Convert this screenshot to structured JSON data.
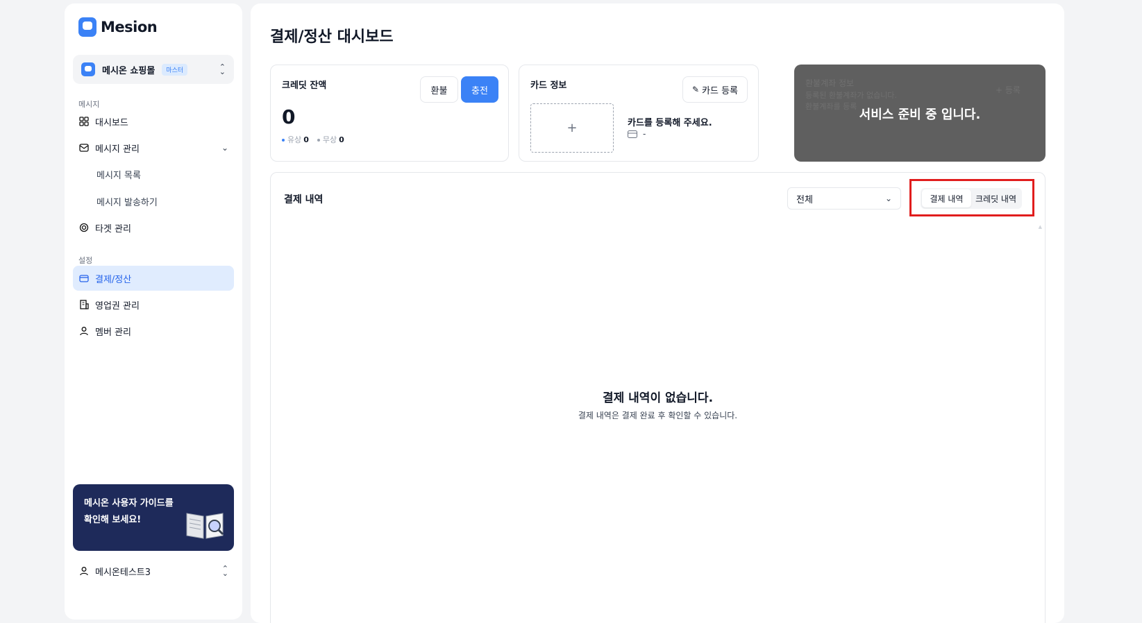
{
  "brand": {
    "name": "Mesion"
  },
  "shop": {
    "name": "메시온 쇼핑몰",
    "badge": "마스터"
  },
  "sidebar": {
    "section_message": "메시지",
    "dashboard": "대시보드",
    "message_mgmt": "메시지 관리",
    "message_list": "메시지 목록",
    "message_send": "메시지 발송하기",
    "target_mgmt": "타겟 관리",
    "section_settings": "설정",
    "billing": "결제/정산",
    "territory_mgmt": "영업권 관리",
    "member_mgmt": "멤버 관리"
  },
  "guide": {
    "line1": "메시온 사용자 가이드를",
    "line2": "확인해 보세요!"
  },
  "user": {
    "name": "메시온테스트3"
  },
  "page": {
    "title": "결제/정산 대시보드"
  },
  "credit": {
    "title": "크레딧 잔액",
    "refund_label": "환불",
    "charge_label": "충전",
    "balance": "0",
    "paid_label": "유상",
    "paid_value": "0",
    "free_label": "무상",
    "free_value": "0"
  },
  "card_info": {
    "title": "카드 정보",
    "register_label": "카드 등록",
    "add_symbol": "+",
    "message": "카드를 등록해 주세요.",
    "number": "-"
  },
  "refund_account": {
    "title": "환불계좌 정보",
    "line1": "등록된 환불계좌가 없습니다.",
    "line2": "환불계좌를 등록",
    "register_label": "+ 등록",
    "overlay": "서비스 준비 중 입니다."
  },
  "history": {
    "title": "결제 내역",
    "filter_value": "전체",
    "tabs": [
      "결제 내역",
      "크레딧 내역"
    ],
    "empty_title": "결제 내역이 없습니다.",
    "empty_sub": "결제 내역은 결제 완료 후 확인할 수 있습니다."
  },
  "colors": {
    "accent": "#3b82f6",
    "highlight": "#e11d1d",
    "guide_bg": "#1e2a5a"
  }
}
